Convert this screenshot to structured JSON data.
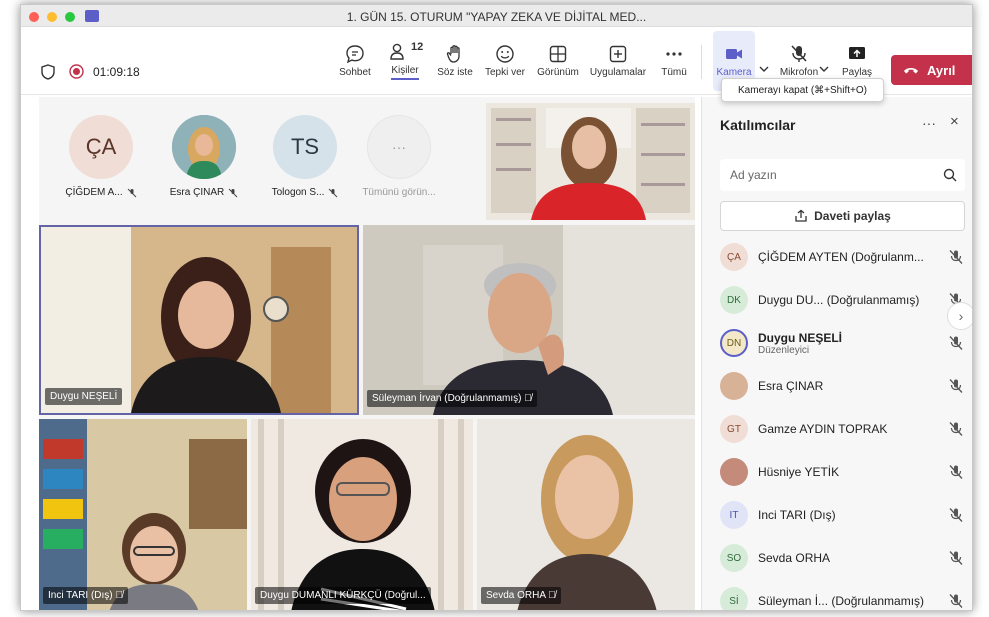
{
  "window": {
    "title": "1. GÜN 15. OTURUM \"YAPAY ZEKA VE DİJİTAL MED..."
  },
  "toolbar": {
    "timer": "01:09:18",
    "chat_label": "Sohbet",
    "people_label": "Kişiler",
    "people_count": "12",
    "raise_label": "Söz iste",
    "react_label": "Tepki ver",
    "view_label": "Görünüm",
    "apps_label": "Uygulamalar",
    "more_label": "Tümü",
    "camera_label": "Kamera",
    "mic_label": "Mikrofon",
    "share_label": "Paylaş",
    "leave_label": "Ayrıl"
  },
  "tooltip": "Kamerayı kapat (⌘+Shift+O)",
  "strip": [
    {
      "initials": "ÇA",
      "name": "ÇİĞDEM A...",
      "bg": "#f0ddd5"
    },
    {
      "initials": "",
      "name": "Esra ÇINAR",
      "bg": "#e4c8b0"
    },
    {
      "initials": "TS",
      "name": "Tologon S...",
      "bg": "#d5e2ea"
    },
    {
      "initials": "···",
      "name": "Tümünü görün...",
      "bg": "#f0f0f0"
    }
  ],
  "tiles": {
    "t1": "Duygu NEŞELİ",
    "t2": "Süleyman İrvan (Doğrulanmamış)",
    "t3": "Inci TARI (Dış)",
    "t4": "Duygu DUMANLI KÜRKÇÜ (Doğrul...",
    "t5": "Sevda ORHA"
  },
  "panel": {
    "title": "Katılımcılar",
    "search_placeholder": "Ad yazın",
    "invite_label": "Daveti paylaş",
    "participants": [
      {
        "initials": "ÇA",
        "name": "ÇİĞDEM AYTEN (Doğrulanm...",
        "sub": "",
        "bg": "#f0ddd5",
        "fg": "#8a4a32"
      },
      {
        "initials": "DK",
        "name": "Duygu DU...  (Doğrulanmamış)",
        "sub": "",
        "bg": "#d6ecd9",
        "fg": "#2f6b3a"
      },
      {
        "initials": "DN",
        "name": "Duygu NEŞELİ",
        "sub": "Düzenleyici",
        "bg": "#f3e9c8",
        "fg": "#6b5a1a"
      },
      {
        "initials": "",
        "name": "Esra ÇINAR",
        "sub": "",
        "bg": "#d8b296",
        "fg": "#333"
      },
      {
        "initials": "GT",
        "name": "Gamze AYDIN TOPRAK",
        "sub": "",
        "bg": "#f0ddd5",
        "fg": "#8a4a32"
      },
      {
        "initials": "",
        "name": "Hüsniye YETİK",
        "sub": "",
        "bg": "#c48a7a",
        "fg": "#333"
      },
      {
        "initials": "IT",
        "name": "Inci TARI (Dış)",
        "sub": "",
        "bg": "#e1e4f7",
        "fg": "#4a54a8"
      },
      {
        "initials": "SO",
        "name": "Sevda ORHA",
        "sub": "",
        "bg": "#d6ecd9",
        "fg": "#2f6b3a"
      },
      {
        "initials": "Sİ",
        "name": "Süleyman İ...  (Doğrulanmamış)",
        "sub": "",
        "bg": "#d6ecd9",
        "fg": "#2f6b3a"
      }
    ]
  }
}
